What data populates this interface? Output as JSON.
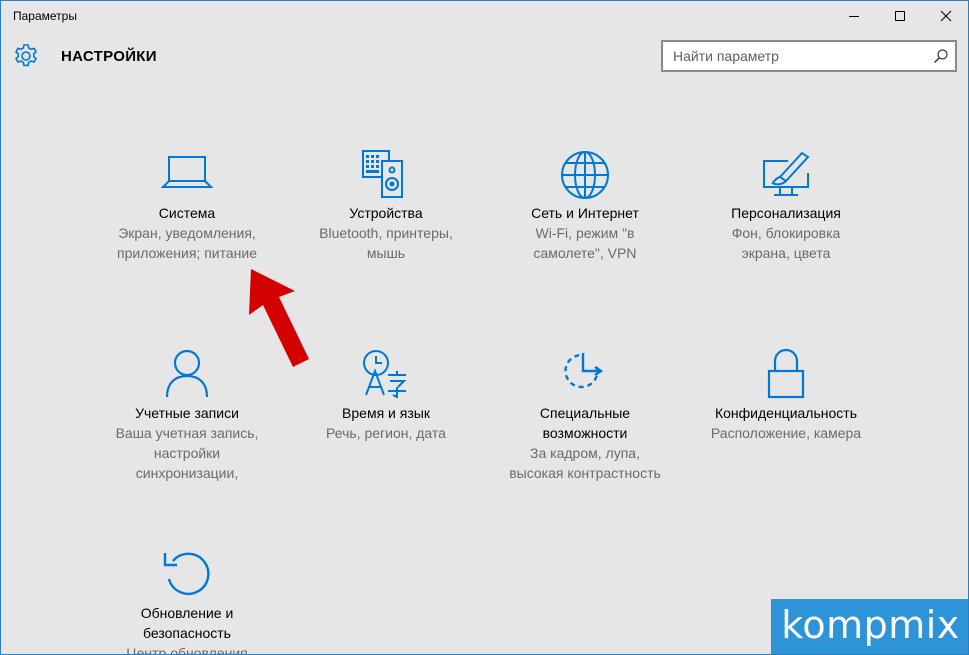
{
  "window": {
    "title": "Параметры"
  },
  "header": {
    "title": "НАСТРОЙКИ",
    "search_placeholder": "Найти параметр"
  },
  "tiles": [
    {
      "title": "Система",
      "desc": [
        "Экран, уведомления,",
        "приложения; питание"
      ],
      "icon": "laptop-icon"
    },
    {
      "title": "Устройства",
      "desc": [
        "Bluetooth, принтеры,",
        "мышь"
      ],
      "icon": "devices-icon"
    },
    {
      "title": "Сеть и Интернет",
      "desc": [
        "Wi-Fi, режим \"в",
        "самолете\", VPN"
      ],
      "icon": "globe-icon"
    },
    {
      "title": "Персонализация",
      "desc": [
        "Фон, блокировка",
        "экрана, цвета"
      ],
      "icon": "personalization-icon"
    },
    {
      "title": "Учетные записи",
      "desc": [
        "Ваша учетная запись,",
        "настройки",
        "синхронизации,"
      ],
      "icon": "person-icon"
    },
    {
      "title": "Время и язык",
      "desc": [
        "Речь, регион, дата"
      ],
      "icon": "time-language-icon"
    },
    {
      "title": "Специальные возможности",
      "title_lines": [
        "Специальные",
        "возможности"
      ],
      "desc": [
        "За кадром, лупа,",
        "высокая контрастность"
      ],
      "icon": "accessibility-icon"
    },
    {
      "title": "Конфиденциальность",
      "desc": [
        "Расположение, камера"
      ],
      "icon": "lock-icon"
    },
    {
      "title": "Обновление и безопасность",
      "title_lines": [
        "Обновление и",
        "безопасность"
      ],
      "desc": [
        "Центр обновления"
      ],
      "icon": "update-icon"
    }
  ],
  "watermark": {
    "text": "kompmix"
  },
  "colors": {
    "accent": "#0078d7",
    "background": "#e6e6e6",
    "arrow": "#d40000"
  }
}
